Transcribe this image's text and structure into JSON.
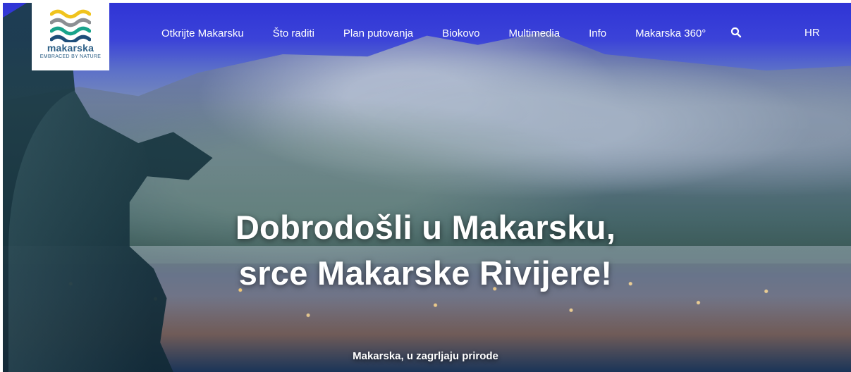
{
  "logo": {
    "name": "makarska",
    "tagline": "EMBRACED BY NATURE"
  },
  "nav": {
    "items": [
      {
        "label": "Otkrijte Makarsku"
      },
      {
        "label": "Što raditi"
      },
      {
        "label": "Plan putovanja"
      },
      {
        "label": "Biokovo"
      },
      {
        "label": "Multimedia"
      },
      {
        "label": "Info"
      },
      {
        "label": "Makarska 360°"
      }
    ],
    "search_icon": "search-icon",
    "language": "HR"
  },
  "hero": {
    "title_line_1": "Dobrodošli u Makarsku,",
    "title_line_2": "srce Makarske Rivijere!",
    "subtitle": "Makarska, u zagrljaju prirode"
  },
  "colors": {
    "sky_blue": "#2f34d6",
    "logo_blue": "#2c5f86",
    "logo_yellow": "#f0c31d",
    "logo_gray": "#8b8f93",
    "logo_green": "#18a38b",
    "logo_navy": "#1e4e7a"
  }
}
